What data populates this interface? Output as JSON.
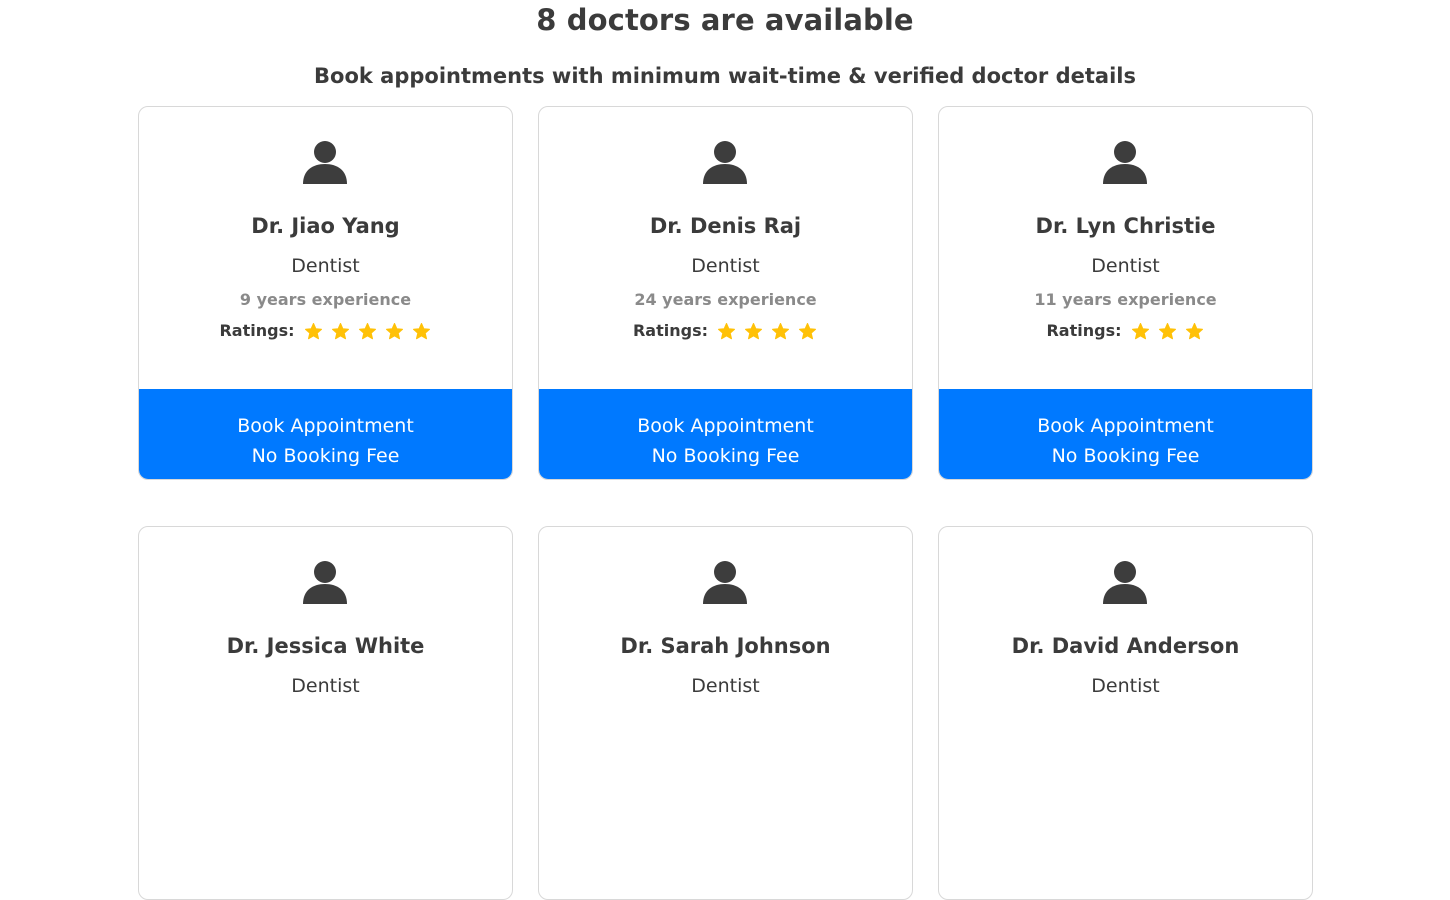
{
  "header": {
    "title": "8 doctors are available",
    "subtitle": "Book appointments with minimum wait-time & verified doctor details"
  },
  "colors": {
    "accent": "#0079FF",
    "star": "#FFC107",
    "text": "#3B3B3B",
    "muted": "#8A8A8A"
  },
  "doctors": [
    {
      "name": "Dr. Jiao Yang",
      "specialty": "Dentist",
      "experience": "9 years experience",
      "ratings_label": "Ratings:",
      "rating": 5,
      "button_line1": "Book Appointment",
      "button_line2": "No Booking Fee"
    },
    {
      "name": "Dr. Denis Raj",
      "specialty": "Dentist",
      "experience": "24 years experience",
      "ratings_label": "Ratings:",
      "rating": 4,
      "button_line1": "Book Appointment",
      "button_line2": "No Booking Fee"
    },
    {
      "name": "Dr. Lyn Christie",
      "specialty": "Dentist",
      "experience": "11 years experience",
      "ratings_label": "Ratings:",
      "rating": 3,
      "button_line1": "Book Appointment",
      "button_line2": "No Booking Fee"
    },
    {
      "name": "Dr. Jessica White",
      "specialty": "Dentist"
    },
    {
      "name": "Dr. Sarah Johnson",
      "specialty": "Dentist"
    },
    {
      "name": "Dr. David Anderson",
      "specialty": "Dentist"
    }
  ],
  "icons": {
    "avatar": "user-avatar-icon",
    "star": "star-icon"
  }
}
